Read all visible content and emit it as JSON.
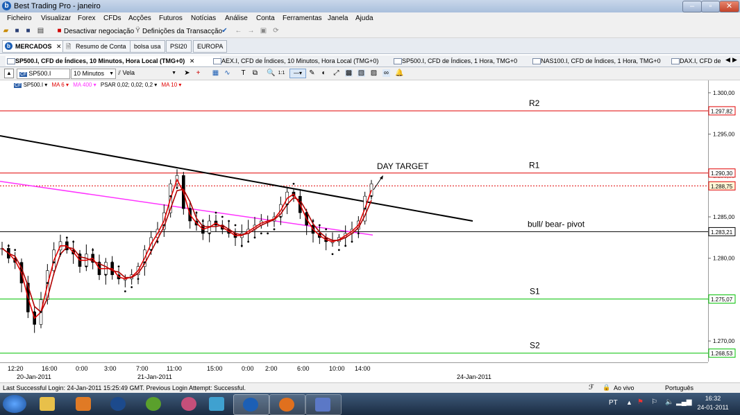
{
  "window": {
    "title": "Best Trading Pro - janeiro",
    "logo": "b"
  },
  "menu": [
    "Ficheiro",
    "Visualizar",
    "Forex",
    "CFDs",
    "Acções",
    "Futuros",
    "Notícias",
    "Análise",
    "Conta",
    "Ferramentas",
    "Janela",
    "Ajuda"
  ],
  "toolbar": {
    "deactivate": "Desactivar negociação",
    "settings": "Definições da Transacção"
  },
  "workspace_tabs": [
    "MERCADOS",
    "Resumo de Conta",
    "bolsa usa",
    "PSI20",
    "EUROPA"
  ],
  "chart_tabs": [
    "SP500.I, CFD de Índices, 10 Minutos, Hora Local (TMG+0)",
    "AEX.I, CFD de Índices, 10 Minutos, Hora Local (TMG+0)",
    "SP500.I, CFD de Índices, 1 Hora, TMG+0",
    "NAS100.I, CFD de Índices, 1 Hora, TMG+0",
    "DAX.I, CFD de"
  ],
  "chart_toolbar": {
    "symbol": "SP500.I",
    "interval": "10 Minutos",
    "chart_type": "Vela"
  },
  "indicators": {
    "symbol": "SP500.I",
    "ma6": "MA 6",
    "ma400": "MA 400",
    "psar": "PSAR 0,02; 0,02; 0,2",
    "ma10": "MA 10"
  },
  "chart_data": {
    "type": "line",
    "ylim": [
      1267.5,
      1301.5
    ],
    "y_ticks": [
      "1.300,00",
      "1.295,00",
      "1.290,00",
      "1.285,00",
      "1.280,00",
      "1.275,00",
      "1.270,00"
    ],
    "y_tick_values": [
      1300,
      1295,
      1290,
      1285,
      1280,
      1275,
      1270
    ],
    "levels": [
      {
        "name": "R2",
        "value": 1297.82,
        "label": "1.297,82",
        "color": "#e00000"
      },
      {
        "name": "R1",
        "value": 1290.3,
        "label": "1.290,30",
        "color": "#e00000"
      },
      {
        "name": "current",
        "value": 1288.75,
        "label": "1.288,75",
        "color": "#e00000",
        "dotted": true
      },
      {
        "name": "bull/ bear- pivot",
        "value": 1283.21,
        "label": "1.283,21",
        "color": "#000000"
      },
      {
        "name": "S1",
        "value": 1275.07,
        "label": "1.275,07",
        "color": "#00c000"
      },
      {
        "name": "S2",
        "value": 1268.53,
        "label": "1.268,53",
        "color": "#00c000"
      }
    ],
    "annotations": {
      "day_target": "DAY TARGET"
    },
    "x_ticks": [
      "12:20",
      "16:00",
      "0:00",
      "3:00",
      "7:00",
      "11:00",
      "15:00",
      "0:00",
      "2:00",
      "6:00",
      "10:00",
      "14:00"
    ],
    "x_dates": [
      "20-Jan-2011",
      "21-Jan-2011",
      "24-Jan-2011"
    ],
    "price_series": {
      "name": "SP500.I",
      "values": [
        1281.2,
        1280.0,
        1279.5,
        1277.0,
        1273.5,
        1272.0,
        1275.0,
        1278.5,
        1281.0,
        1282.0,
        1281.0,
        1280.5,
        1279.0,
        1280.5,
        1279.5,
        1278.0,
        1279.5,
        1278.0,
        1277.5,
        1277.5,
        1278.0,
        1279.0,
        1281.0,
        1282.5,
        1283.5,
        1285.5,
        1289.0,
        1290.0,
        1286.0,
        1284.5,
        1284.0,
        1283.0,
        1284.5,
        1284.0,
        1283.5,
        1283.0,
        1282.5,
        1283.0,
        1283.5,
        1284.0,
        1284.5,
        1284.5,
        1285.0,
        1286.5,
        1288.0,
        1287.5,
        1285.5,
        1284.0,
        1283.0,
        1282.5,
        1282.0,
        1282.0,
        1282.5,
        1283.0,
        1283.5,
        1284.5,
        1287.5,
        1289.0
      ]
    },
    "ma_400": {
      "name": "MA 400",
      "start": 1289.3,
      "end": 1282.8,
      "color": "#ff33ff"
    },
    "trend_line": {
      "start": 1294.8,
      "end": 1284.5
    }
  },
  "status": {
    "login": "Last Successful Login: 24-Jan-2011 15:25:49 GMT. Previous Login Attempt: Successful.",
    "live": "Ao vivo",
    "language": "Português"
  },
  "taskbar": {
    "lang": "PT",
    "time": "16:32",
    "date": "24-01-2011"
  }
}
